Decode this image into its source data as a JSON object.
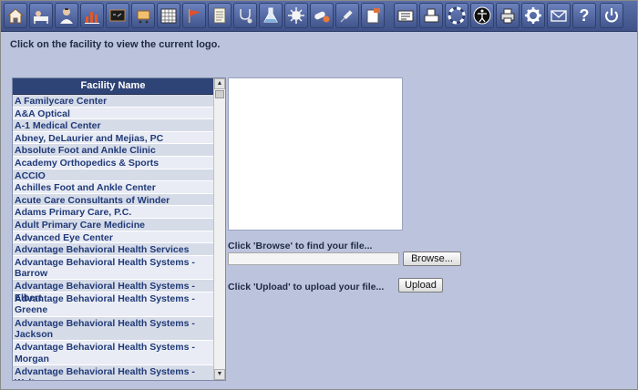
{
  "toolbar": {
    "icons": [
      "home-icon",
      "patient-icon",
      "doctor-icon",
      "reports-chart-icon",
      "chalkboard-icon",
      "cart-icon",
      "calendar-icon",
      "flag-icon",
      "notepad-icon",
      "stethoscope-icon",
      "flask-icon",
      "starburst-icon",
      "pills-icon",
      "syringe-icon",
      "form-icon",
      "id-card-icon",
      "printer-fax-icon",
      "lifebuoy-icon",
      "accessibility-icon",
      "printer-icon",
      "gear-icon",
      "mail-icon",
      "help-icon",
      "power-icon"
    ]
  },
  "instruction": "Click on the facility to view the current logo.",
  "facility_list": {
    "header": "Facility Name",
    "items": [
      "A Familycare Center",
      "A&A Optical",
      "A-1 Medical Center",
      "Abney, DeLaurier and Mejias, PC",
      "Absolute Foot and Ankle Clinic",
      "Academy Orthopedics & Sports",
      "ACCIO",
      "Achilles Foot and Ankle Center",
      "Acute Care Consultants of Winder",
      "Adams Primary Care, P.C.",
      "Adult Primary Care Medicine",
      "Advanced Eye Center",
      "Advantage Behavioral Health Services",
      "Advantage Behavioral Health Systems - Barrow",
      "Advantage Behavioral Health Systems - Elbert",
      "Advantage Behavioral Health Systems - Greene",
      "Advantage Behavioral Health Systems - Jackson",
      "Advantage Behavioral Health Systems - Morgan",
      "Advantage Behavioral Health Systems - Walton"
    ]
  },
  "upload": {
    "browse_instruction": "Click 'Browse' to find your file...",
    "browse_label": "Browse...",
    "upload_instruction": "Click 'Upload' to upload your file...",
    "upload_label": "Upload"
  }
}
